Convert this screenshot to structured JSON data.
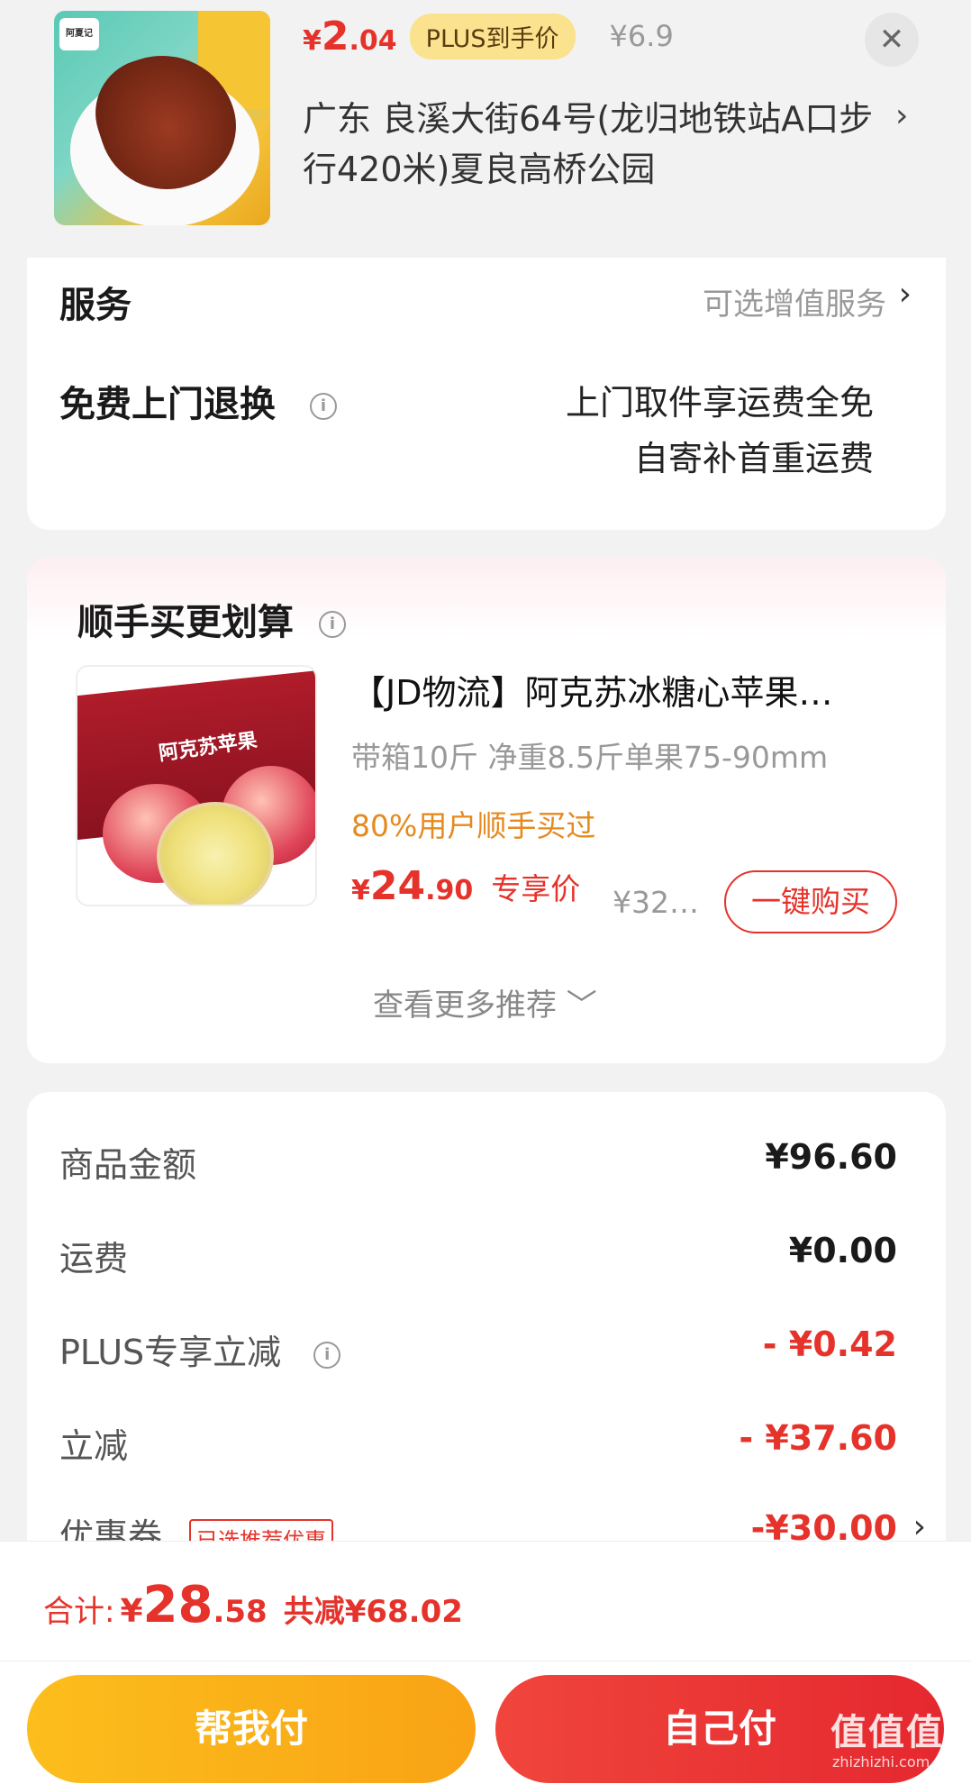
{
  "product": {
    "price_yen": "¥",
    "price_int": "2",
    "price_dec": ".04",
    "plus_badge": "PLUS到手价",
    "original_price": "¥6.9",
    "address": "广东  良溪大街64号(龙归地铁站A口步行420米)夏良高桥公园",
    "close_glyph": "✕",
    "chevron_glyph": "›",
    "thumb_logo_text": "阿夏记"
  },
  "service": {
    "title": "服务",
    "optional_label": "可选增值服务",
    "chevron_glyph": "›",
    "free_return_label": "免费上门退换",
    "info_glyph": "i",
    "lines": [
      "上门取件享运费全免",
      "自寄补首重运费"
    ]
  },
  "recommend": {
    "title": "顺手买更划算",
    "info_glyph": "i",
    "item": {
      "name": "【JD物流】阿克苏冰糖心苹果…",
      "spec": "带箱10斤 净重8.5斤单果75-90mm",
      "bought": "80%用户顺手买过",
      "price_yen": "¥",
      "price_int": "24",
      "price_dec": ".90",
      "exclusive": "专享价",
      "original": "¥32…",
      "buy_label": "一键购买",
      "box_label": "阿克苏苹果"
    },
    "more_label": "查看更多推荐 ﹀"
  },
  "summary": {
    "rows": [
      {
        "label": "商品金额",
        "value": "¥96.60"
      },
      {
        "label": "运费",
        "value": "¥0.00"
      },
      {
        "label": "PLUS专享立减",
        "value": "- ¥0.42"
      },
      {
        "label": "立减",
        "value": "- ¥37.60"
      },
      {
        "label": "优惠券",
        "tag": "已选推荐优惠",
        "value": "-¥30.00"
      }
    ],
    "info_glyph": "i",
    "chevron_glyph": "›"
  },
  "footer": {
    "total_label": "合计:",
    "total_yen": "¥",
    "total_int": "28",
    "total_dec": ".58",
    "saved": "共减¥68.02",
    "help_pay": "帮我付",
    "self_pay": "自己付"
  },
  "watermark": {
    "text": "值值值",
    "site": "zhizhizhi.com"
  },
  "colors": {
    "accent_red": "#e5332b",
    "accent_yellow": "#fcbe1c",
    "orange_text": "#e58a1f",
    "plus_pill": "#fbe28e"
  }
}
